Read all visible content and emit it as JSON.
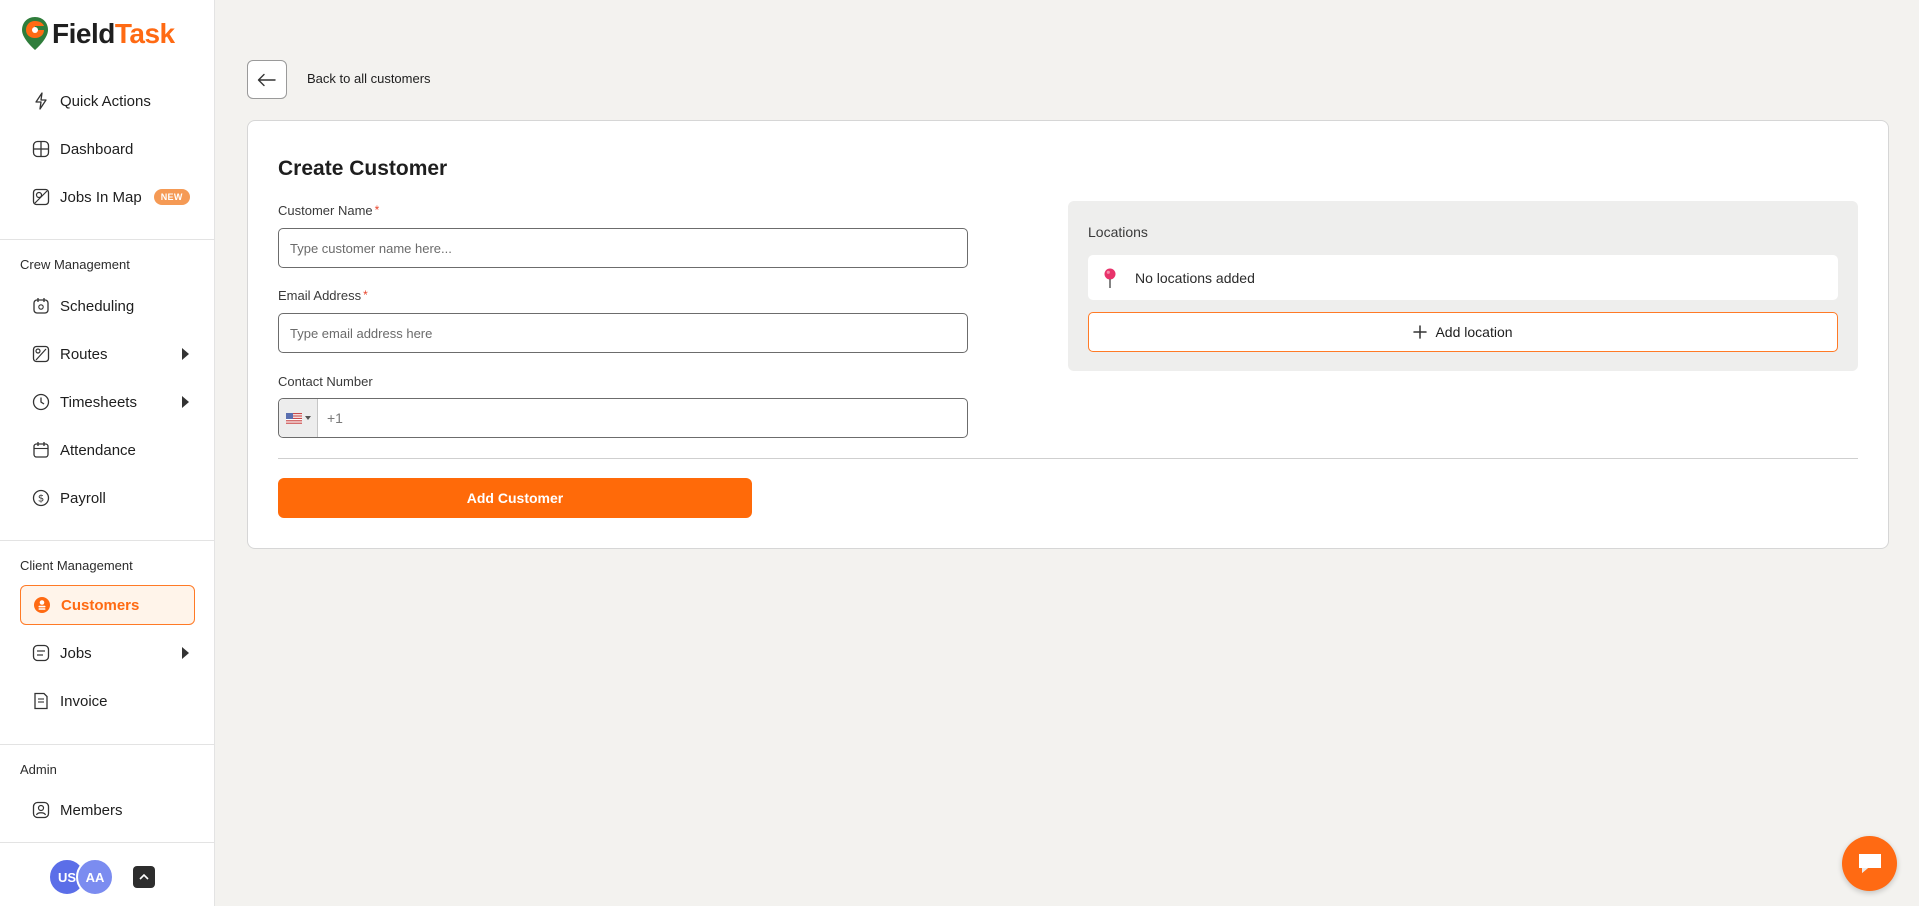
{
  "brand": {
    "name_part1": "Field",
    "name_part2": "Task",
    "accent": "#ff6a13"
  },
  "sidebar": {
    "items_top": [
      {
        "label": "Quick Actions",
        "icon": "bolt-icon"
      },
      {
        "label": "Dashboard",
        "icon": "grid-icon"
      },
      {
        "label": "Jobs In Map",
        "icon": "map-icon",
        "badge": "NEW"
      }
    ],
    "crew_heading": "Crew Management",
    "crew_items": [
      {
        "label": "Scheduling",
        "icon": "calendar-icon"
      },
      {
        "label": "Routes",
        "icon": "route-icon"
      },
      {
        "label": "Timesheets",
        "icon": "clock-icon"
      },
      {
        "label": "Attendance",
        "icon": "attendance-icon"
      },
      {
        "label": "Payroll",
        "icon": "dollar-icon"
      }
    ],
    "client_heading": "Client Management",
    "client_items": [
      {
        "label": "Customers",
        "icon": "customer-icon",
        "active": true
      },
      {
        "label": "Jobs",
        "icon": "jobs-icon"
      },
      {
        "label": "Invoice",
        "icon": "invoice-icon"
      }
    ],
    "admin_heading": "Admin",
    "admin_items": [
      {
        "label": "Members",
        "icon": "members-icon"
      }
    ],
    "avatars": [
      "US",
      "AA"
    ]
  },
  "header": {
    "back_label": "Back to all customers"
  },
  "form": {
    "title": "Create Customer",
    "name_label": "Customer Name",
    "name_placeholder": "Type customer name here...",
    "email_label": "Email Address",
    "email_placeholder": "Type email address here",
    "required_mark": "*",
    "phone_label": "Contact Number",
    "phone_placeholder": "+1",
    "submit_label": "Add Customer"
  },
  "locations": {
    "title": "Locations",
    "empty_text": "No locations added",
    "add_label": "Add location"
  }
}
